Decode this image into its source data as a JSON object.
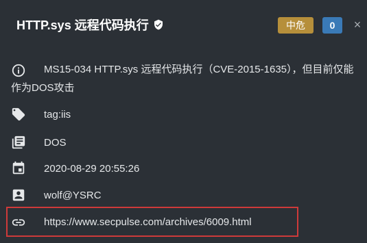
{
  "header": {
    "title": "HTTP.sys 远程代码执行",
    "level_badge": "中危",
    "count_badge": "0",
    "close_glyph": "×"
  },
  "details": {
    "description": "MS15-034 HTTP.sys 远程代码执行（CVE-2015-1635），但目前仅能作为DOS攻击",
    "tag": "tag:iis",
    "category": "DOS",
    "datetime": "2020-08-29 20:55:26",
    "author": "wolf@YSRC",
    "reference_url": "https://www.secpulse.com/archives/6009.html"
  },
  "icons": {
    "title": "verified-shield-icon",
    "description": "info-icon",
    "tag": "tag-icon",
    "category": "library-books-icon",
    "datetime": "calendar-icon",
    "author": "account-box-icon",
    "reference_url": "link-icon"
  },
  "colors": {
    "background": "#2b3036",
    "level_badge": "#b68f3b",
    "count_badge": "#3a7ab7",
    "link": "#3d7fc0",
    "highlight_border": "#cf3a3a"
  }
}
